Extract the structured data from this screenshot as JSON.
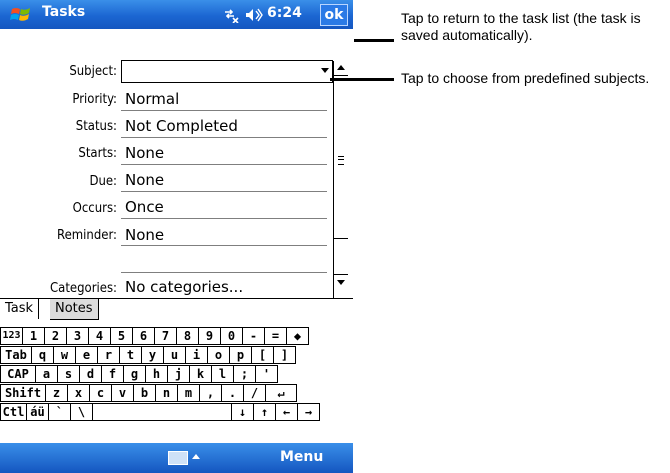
{
  "titlebar": {
    "title": "Tasks",
    "time": "6:24",
    "ok_label": "ok"
  },
  "form": {
    "fields": [
      {
        "label": "Subject:",
        "value": ""
      },
      {
        "label": "Priority:",
        "value": "Normal"
      },
      {
        "label": "Status:",
        "value": "Not Completed"
      },
      {
        "label": "Starts:",
        "value": "None"
      },
      {
        "label": "Due:",
        "value": "None"
      },
      {
        "label": "Occurs:",
        "value": "Once"
      },
      {
        "label": "Reminder:",
        "value": "None"
      },
      {
        "label": "Categories:",
        "value": "No categories..."
      }
    ]
  },
  "tabs": [
    {
      "label": "Task"
    },
    {
      "label": "Notes"
    }
  ],
  "keyboard": {
    "rows": [
      [
        "123",
        "1",
        "2",
        "3",
        "4",
        "5",
        "6",
        "7",
        "8",
        "9",
        "0",
        "-",
        "=",
        "◆"
      ],
      [
        "Tab",
        "q",
        "w",
        "e",
        "r",
        "t",
        "y",
        "u",
        "i",
        "o",
        "p",
        "[",
        "]"
      ],
      [
        "CAP",
        "a",
        "s",
        "d",
        "f",
        "g",
        "h",
        "j",
        "k",
        "l",
        ";",
        "'"
      ],
      [
        "Shift",
        "z",
        "x",
        "c",
        "v",
        "b",
        "n",
        "m",
        ",",
        ".",
        "/",
        "↵"
      ],
      [
        "Ctl",
        "áü",
        "`",
        "\\",
        "",
        "↓",
        "↑",
        "←",
        "→"
      ]
    ]
  },
  "bottombar": {
    "menu_label": "Menu"
  },
  "callouts": [
    {
      "text": "Tap to return to the task list (the task is saved automatically)."
    },
    {
      "text": "Tap to choose from predefined subjects."
    }
  ],
  "icons": {
    "start": "windows-flag-icon",
    "connectivity": "connectivity-icon",
    "volume": "speaker-icon",
    "keyboard": "keyboard-icon"
  }
}
